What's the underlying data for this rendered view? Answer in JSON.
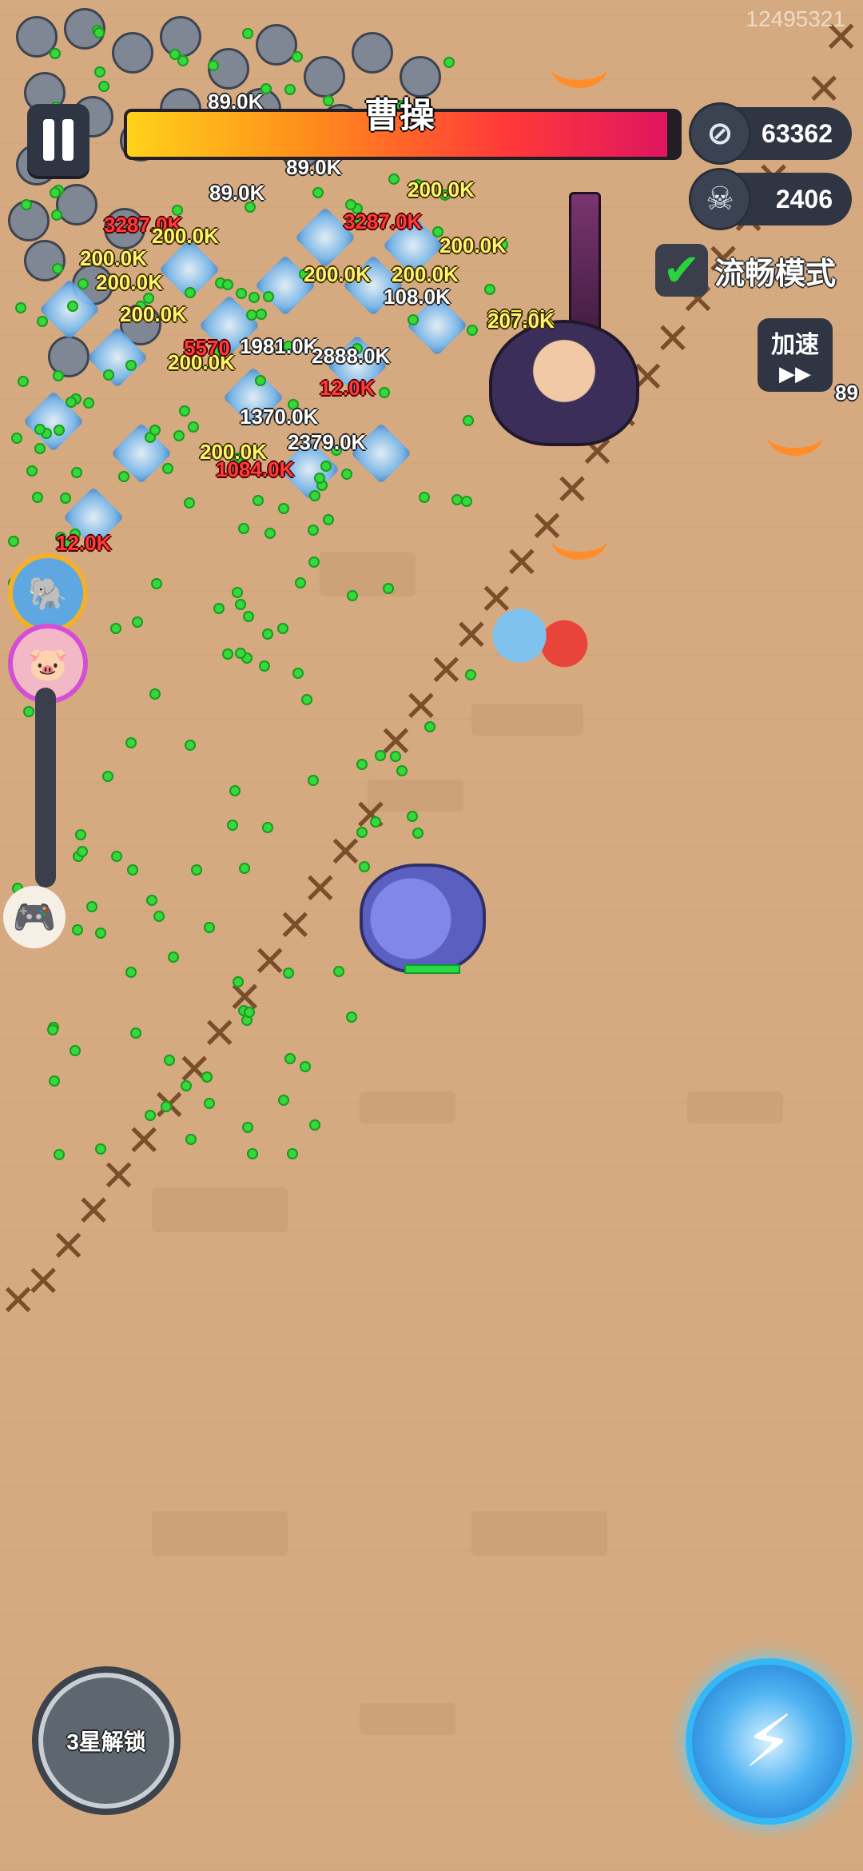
{
  "hud": {
    "id_text": "12495321",
    "boss_name": "曹操",
    "boss_hp_percent": 98,
    "coins": "63362",
    "kills": "2406",
    "smooth_mode_label": "流畅模式",
    "speed_label": "加速",
    "speed_icon": "fast-forward-icon"
  },
  "skills": {
    "left_label": "3星解锁",
    "right_icon": "lightning-icon"
  },
  "damage_numbers": [
    {
      "text": "89.0K",
      "style": "white"
    },
    {
      "text": "89.0K",
      "style": "white"
    },
    {
      "text": "89.0K",
      "style": "white"
    },
    {
      "text": "3287.0K",
      "style": "red"
    },
    {
      "text": "3287.0K",
      "style": "red"
    },
    {
      "text": "200.0K",
      "style": "yellow"
    },
    {
      "text": "200.0K",
      "style": "yellow"
    },
    {
      "text": "200.0K",
      "style": "yellow"
    },
    {
      "text": "200.0K",
      "style": "yellow"
    },
    {
      "text": "200.0K",
      "style": "yellow"
    },
    {
      "text": "200.0K",
      "style": "yellow"
    },
    {
      "text": "207.0K",
      "style": "yellow"
    },
    {
      "text": "200.0K",
      "style": "yellow"
    },
    {
      "text": "200.0K",
      "style": "yellow"
    },
    {
      "text": "1981.0K",
      "style": "white"
    },
    {
      "text": "2888.0K",
      "style": "white"
    },
    {
      "text": "1370.0K",
      "style": "white"
    },
    {
      "text": "2379.0K",
      "style": "white"
    },
    {
      "text": "1084.0K",
      "style": "red"
    },
    {
      "text": "12.0K",
      "style": "red"
    },
    {
      "text": "108.0K",
      "style": "white"
    },
    {
      "text": "207.0K",
      "style": "yellow"
    },
    {
      "text": "200.0K",
      "style": "yellow"
    },
    {
      "text": "200.0K",
      "style": "yellow"
    },
    {
      "text": "5570",
      "style": "red"
    },
    {
      "text": "12.0K",
      "style": "red"
    },
    {
      "text": "89",
      "style": "white"
    }
  ],
  "colors": {
    "ground": "#d6aa80",
    "hp_start": "#ffd21a",
    "hp_end": "#e01560",
    "check": "#2bd23c"
  }
}
